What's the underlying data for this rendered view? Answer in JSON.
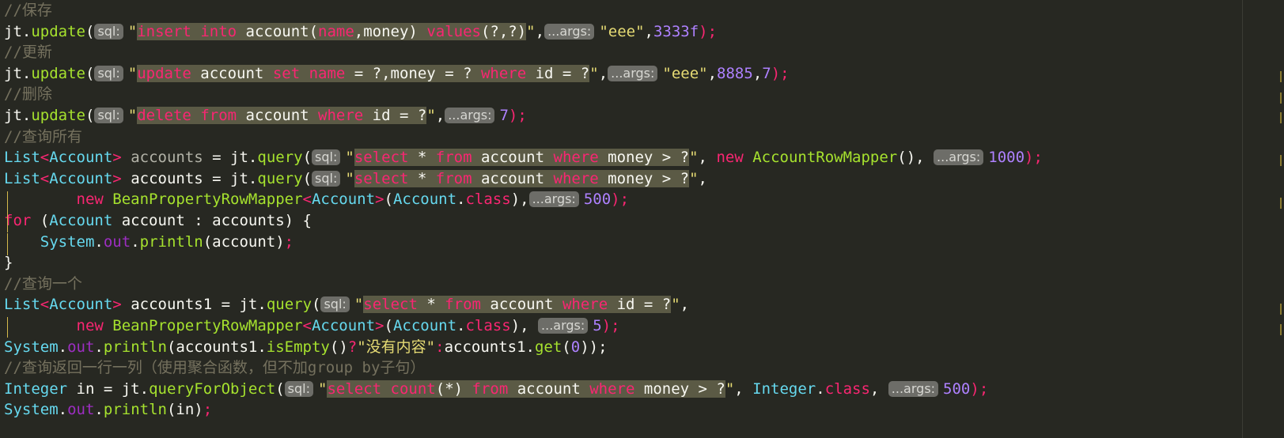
{
  "code": {
    "lines": [
      [
        {
          "t": "//保存",
          "c": "cm"
        }
      ],
      [
        {
          "t": "jt",
          "c": "pu"
        },
        {
          "t": ".",
          "c": "pu"
        },
        {
          "t": "update",
          "c": "md"
        },
        {
          "t": "(",
          "c": "pu"
        },
        {
          "h": "sql:"
        },
        {
          "t": "\"",
          "c": "st"
        },
        {
          "t": "insert",
          "c": "kw",
          "s": 1
        },
        {
          "t": " ",
          "s": 1
        },
        {
          "t": "into",
          "c": "kw",
          "s": 1
        },
        {
          "t": " account(",
          "c": "pu",
          "s": 1
        },
        {
          "t": "name",
          "c": "kw",
          "s": 1
        },
        {
          "t": ",money) ",
          "c": "pu",
          "s": 1
        },
        {
          "t": "values",
          "c": "kw",
          "s": 1
        },
        {
          "t": "(?,?)",
          "c": "pu",
          "s": 1
        },
        {
          "t": "\"",
          "c": "st"
        },
        {
          "t": ",",
          "c": "pu"
        },
        {
          "h": "...args:"
        },
        {
          "t": "\"eee\"",
          "c": "st"
        },
        {
          "t": ",",
          "c": "pu"
        },
        {
          "t": "3333f",
          "c": "nu"
        },
        {
          "t": ");",
          "c": "kw"
        }
      ],
      [
        {
          "t": "//更新",
          "c": "cm"
        }
      ],
      [
        {
          "t": "jt",
          "c": "pu"
        },
        {
          "t": ".",
          "c": "pu"
        },
        {
          "t": "update",
          "c": "md"
        },
        {
          "t": "(",
          "c": "pu"
        },
        {
          "h": "sql:"
        },
        {
          "t": "\"",
          "c": "st"
        },
        {
          "t": "update",
          "c": "kw",
          "s": 1
        },
        {
          "t": " account ",
          "c": "pu",
          "s": 1
        },
        {
          "t": "set",
          "c": "kw",
          "s": 1
        },
        {
          "t": " ",
          "s": 1
        },
        {
          "t": "name",
          "c": "kw",
          "s": 1
        },
        {
          "t": " = ?,money = ? ",
          "c": "pu",
          "s": 1
        },
        {
          "t": "where",
          "c": "kw",
          "s": 1
        },
        {
          "t": " id = ?",
          "c": "pu",
          "s": 1
        },
        {
          "t": "\"",
          "c": "st"
        },
        {
          "t": ",",
          "c": "pu"
        },
        {
          "h": "...args:"
        },
        {
          "t": "\"eee\"",
          "c": "st"
        },
        {
          "t": ",",
          "c": "pu"
        },
        {
          "t": "8885",
          "c": "nu"
        },
        {
          "t": ",",
          "c": "pu"
        },
        {
          "t": "7",
          "c": "nu"
        },
        {
          "t": ");",
          "c": "kw"
        }
      ],
      [
        {
          "t": "//删除",
          "c": "cm"
        }
      ],
      [
        {
          "t": "jt",
          "c": "pu"
        },
        {
          "t": ".",
          "c": "pu"
        },
        {
          "t": "update",
          "c": "md"
        },
        {
          "t": "(",
          "c": "pu"
        },
        {
          "h": "sql:"
        },
        {
          "t": "\"",
          "c": "st"
        },
        {
          "t": "delete",
          "c": "kw",
          "s": 1
        },
        {
          "t": " ",
          "s": 1
        },
        {
          "t": "from",
          "c": "kw",
          "s": 1
        },
        {
          "t": " account ",
          "c": "pu",
          "s": 1
        },
        {
          "t": "where",
          "c": "kw",
          "s": 1
        },
        {
          "t": " id = ?",
          "c": "pu",
          "s": 1
        },
        {
          "t": "\"",
          "c": "st"
        },
        {
          "t": ",",
          "c": "pu"
        },
        {
          "h": "...args:"
        },
        {
          "t": "7",
          "c": "nu"
        },
        {
          "t": ");",
          "c": "kw"
        }
      ],
      [
        {
          "t": "//查询所有",
          "c": "cm"
        }
      ],
      [
        {
          "t": "List",
          "c": "ty"
        },
        {
          "t": "<",
          "c": "kw"
        },
        {
          "t": "Account",
          "c": "ty"
        },
        {
          "t": ">",
          "c": "kw"
        },
        {
          "t": " accounts",
          "c": "gv"
        },
        {
          "t": " = ",
          "c": "pu"
        },
        {
          "t": "jt",
          "c": "pu"
        },
        {
          "t": ".",
          "c": "pu"
        },
        {
          "t": "query",
          "c": "md"
        },
        {
          "t": "(",
          "c": "pu"
        },
        {
          "h": "sql:"
        },
        {
          "t": "\"",
          "c": "st"
        },
        {
          "t": "select",
          "c": "kw",
          "s": 1
        },
        {
          "t": " * ",
          "c": "pu",
          "s": 1
        },
        {
          "t": "from",
          "c": "kw",
          "s": 1
        },
        {
          "t": " account ",
          "c": "pu",
          "s": 1
        },
        {
          "t": "where",
          "c": "kw",
          "s": 1
        },
        {
          "t": " money > ?",
          "c": "pu",
          "s": 1
        },
        {
          "t": "\"",
          "c": "st"
        },
        {
          "t": ", ",
          "c": "pu"
        },
        {
          "t": "new",
          "c": "kw"
        },
        {
          "t": " ",
          "c": "pu"
        },
        {
          "t": "AccountRowMapper",
          "c": "md"
        },
        {
          "t": "(), ",
          "c": "pu"
        },
        {
          "h": "...args:"
        },
        {
          "t": "1000",
          "c": "nu"
        },
        {
          "t": ");",
          "c": "kw"
        }
      ],
      [
        {
          "t": "List",
          "c": "ty"
        },
        {
          "t": "<",
          "c": "kw"
        },
        {
          "t": "Account",
          "c": "ty"
        },
        {
          "t": ">",
          "c": "kw"
        },
        {
          "t": " accounts = ",
          "c": "pu"
        },
        {
          "t": "jt",
          "c": "pu"
        },
        {
          "t": ".",
          "c": "pu"
        },
        {
          "t": "query",
          "c": "md"
        },
        {
          "t": "(",
          "c": "pu"
        },
        {
          "h": "sql:"
        },
        {
          "t": "\"",
          "c": "st"
        },
        {
          "t": "select",
          "c": "kw",
          "s": 1
        },
        {
          "t": " * ",
          "c": "pu",
          "s": 1
        },
        {
          "t": "from",
          "c": "kw",
          "s": 1
        },
        {
          "t": " account ",
          "c": "pu",
          "s": 1
        },
        {
          "t": "where",
          "c": "kw",
          "s": 1
        },
        {
          "t": " money > ?",
          "c": "pu",
          "s": 1
        },
        {
          "t": "\"",
          "c": "st"
        },
        {
          "t": ",",
          "c": "pu"
        }
      ],
      [
        {
          "t": "        "
        },
        {
          "t": "new",
          "c": "kw"
        },
        {
          "t": " ",
          "c": "pu"
        },
        {
          "t": "BeanPropertyRowMapper",
          "c": "md"
        },
        {
          "t": "<",
          "c": "kw"
        },
        {
          "t": "Account",
          "c": "ty"
        },
        {
          "t": ">",
          "c": "kw"
        },
        {
          "t": "(",
          "c": "pu"
        },
        {
          "t": "Account",
          "c": "ty"
        },
        {
          "t": ".",
          "c": "pu"
        },
        {
          "t": "class",
          "c": "kw"
        },
        {
          "t": "),",
          "c": "pu"
        },
        {
          "h": "...args:"
        },
        {
          "t": "500",
          "c": "nu"
        },
        {
          "t": ");",
          "c": "kw"
        }
      ],
      [
        {
          "t": "for",
          "c": "kw"
        },
        {
          "t": " (",
          "c": "pu"
        },
        {
          "t": "Account",
          "c": "ty"
        },
        {
          "t": " account : accounts) {",
          "c": "pu"
        }
      ],
      [
        {
          "t": "    "
        },
        {
          "t": "System",
          "c": "ty"
        },
        {
          "t": ".",
          "c": "pu"
        },
        {
          "t": "out",
          "c": "fd"
        },
        {
          "t": ".",
          "c": "pu"
        },
        {
          "t": "println",
          "c": "md"
        },
        {
          "t": "(account)",
          "c": "pu"
        },
        {
          "t": ";",
          "c": "kw"
        }
      ],
      [
        {
          "t": "}",
          "c": "pu"
        }
      ],
      [
        {
          "t": "//查询一个",
          "c": "cm"
        }
      ],
      [
        {
          "t": "List",
          "c": "ty"
        },
        {
          "t": "<",
          "c": "kw"
        },
        {
          "t": "Account",
          "c": "ty"
        },
        {
          "t": ">",
          "c": "kw"
        },
        {
          "t": " accounts1 = ",
          "c": "pu"
        },
        {
          "t": "jt",
          "c": "pu"
        },
        {
          "t": ".",
          "c": "pu"
        },
        {
          "t": "query",
          "c": "md"
        },
        {
          "t": "(",
          "c": "pu"
        },
        {
          "h": "sql:"
        },
        {
          "t": "\"",
          "c": "st"
        },
        {
          "t": "select",
          "c": "kw",
          "s": 1
        },
        {
          "t": " * ",
          "c": "pu",
          "s": 1
        },
        {
          "t": "from",
          "c": "kw",
          "s": 1
        },
        {
          "t": " account ",
          "c": "pu",
          "s": 1
        },
        {
          "t": "where",
          "c": "kw",
          "s": 1
        },
        {
          "t": " id = ?",
          "c": "pu",
          "s": 1
        },
        {
          "t": "\"",
          "c": "st"
        },
        {
          "t": ",",
          "c": "pu"
        }
      ],
      [
        {
          "t": "        "
        },
        {
          "t": "new",
          "c": "kw"
        },
        {
          "t": " ",
          "c": "pu"
        },
        {
          "t": "BeanPropertyRowMapper",
          "c": "md"
        },
        {
          "t": "<",
          "c": "kw"
        },
        {
          "t": "Account",
          "c": "ty"
        },
        {
          "t": ">",
          "c": "kw"
        },
        {
          "t": "(",
          "c": "pu"
        },
        {
          "t": "Account",
          "c": "ty"
        },
        {
          "t": ".",
          "c": "pu"
        },
        {
          "t": "class",
          "c": "kw"
        },
        {
          "t": "), ",
          "c": "pu"
        },
        {
          "h": "...args:"
        },
        {
          "t": "5",
          "c": "nu"
        },
        {
          "t": ");",
          "c": "kw"
        }
      ],
      [
        {
          "t": "System",
          "c": "ty"
        },
        {
          "t": ".",
          "c": "pu"
        },
        {
          "t": "out",
          "c": "fd"
        },
        {
          "t": ".",
          "c": "pu"
        },
        {
          "t": "println",
          "c": "md"
        },
        {
          "t": "(accounts1.",
          "c": "pu"
        },
        {
          "t": "isEmpty",
          "c": "md"
        },
        {
          "t": "()",
          "c": "pu"
        },
        {
          "t": "?",
          "c": "kw"
        },
        {
          "t": "\"没有内容\"",
          "c": "st"
        },
        {
          "t": ":",
          "c": "kw"
        },
        {
          "t": "accounts1.",
          "c": "pu"
        },
        {
          "t": "get",
          "c": "md"
        },
        {
          "t": "(",
          "c": "pu"
        },
        {
          "t": "0",
          "c": "nu"
        },
        {
          "t": "));",
          "c": "pu"
        }
      ],
      [
        {
          "t": "//查询返回一行一列（使用聚合函数，但不加group by子句）",
          "c": "cm"
        }
      ],
      [
        {
          "t": "Integer",
          "c": "ty"
        },
        {
          "t": " in = ",
          "c": "pu"
        },
        {
          "t": "jt",
          "c": "pu"
        },
        {
          "t": ".",
          "c": "pu"
        },
        {
          "t": "queryForObject",
          "c": "md"
        },
        {
          "t": "(",
          "c": "pu"
        },
        {
          "h": "sql:"
        },
        {
          "t": "\"",
          "c": "st"
        },
        {
          "t": "select",
          "c": "kw",
          "s": 1
        },
        {
          "t": " ",
          "s": 1
        },
        {
          "t": "count",
          "c": "kw",
          "s": 1
        },
        {
          "t": "(*) ",
          "c": "pu",
          "s": 1
        },
        {
          "t": "from",
          "c": "kw",
          "s": 1
        },
        {
          "t": " account ",
          "c": "pu",
          "s": 1
        },
        {
          "t": "where",
          "c": "kw",
          "s": 1
        },
        {
          "t": " money > ?",
          "c": "pu",
          "s": 1
        },
        {
          "t": "\"",
          "c": "st"
        },
        {
          "t": ", ",
          "c": "pu"
        },
        {
          "t": "Integer",
          "c": "ty"
        },
        {
          "t": ".",
          "c": "pu"
        },
        {
          "t": "class",
          "c": "kw"
        },
        {
          "t": ", ",
          "c": "pu"
        },
        {
          "h": "...args:"
        },
        {
          "t": "500",
          "c": "nu"
        },
        {
          "t": ");",
          "c": "kw"
        }
      ],
      [
        {
          "t": "System",
          "c": "ty"
        },
        {
          "t": ".",
          "c": "pu"
        },
        {
          "t": "out",
          "c": "fd"
        },
        {
          "t": ".",
          "c": "pu"
        },
        {
          "t": "println",
          "c": "md"
        },
        {
          "t": "(in)",
          "c": "pu"
        },
        {
          "t": ";",
          "c": "kw"
        }
      ]
    ]
  }
}
